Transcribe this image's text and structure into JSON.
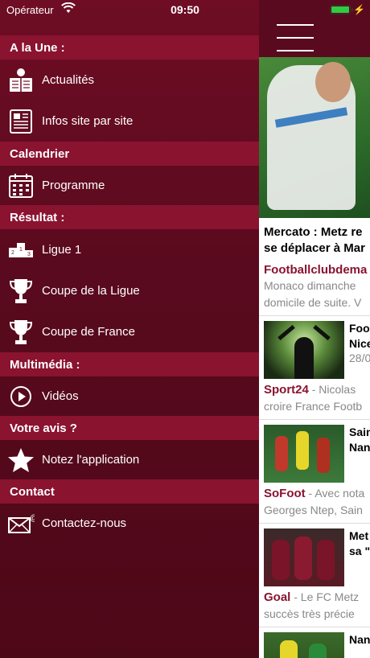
{
  "status_bar": {
    "carrier": "Opérateur",
    "time": "09:50",
    "battery_level": 1.0
  },
  "menu": {
    "sections": [
      {
        "title": "A la Une :",
        "items": [
          {
            "label": "Actualités",
            "icon": "newspaper-reader-icon"
          },
          {
            "label": "Infos site par site",
            "icon": "newspaper-icon"
          }
        ]
      },
      {
        "title": "Calendrier",
        "items": [
          {
            "label": "Programme",
            "icon": "calendar-icon"
          }
        ]
      },
      {
        "title": "Résultat :",
        "items": [
          {
            "label": "Ligue 1",
            "icon": "podium-icon"
          },
          {
            "label": "Coupe de la Ligue",
            "icon": "trophy-icon"
          },
          {
            "label": "Coupe de France",
            "icon": "trophy-icon"
          }
        ]
      },
      {
        "title": "Multimédia :",
        "items": [
          {
            "label": "Vidéos",
            "icon": "play-circle-icon"
          }
        ]
      },
      {
        "title": "Votre avis ?",
        "items": [
          {
            "label": "Notez l'application",
            "icon": "star-icon"
          }
        ]
      },
      {
        "title": "Contact",
        "items": [
          {
            "label": "Contactez-nous",
            "icon": "email-icon"
          }
        ]
      }
    ]
  },
  "feed": {
    "featured": {
      "title_line1": "Mercato : Metz re",
      "title_line2": "se déplacer à Mar",
      "source": "Footballclubdema",
      "snippet_line1": "Monaco dimanche",
      "snippet_line2": "domicile de suite. V"
    },
    "articles": [
      {
        "title_line1": "Foo",
        "title_line2": "Nice",
        "date": "28/0",
        "source": "Sport24",
        "snippet_line1": " - Nicolas",
        "snippet_line2": "croire France Footb"
      },
      {
        "title_line1": "Sain",
        "title_line2": "Nan",
        "date": "",
        "source": "SoFoot",
        "snippet_line1": " - Avec nota",
        "snippet_line2": "Georges Ntep, Sain"
      },
      {
        "title_line1": "Met",
        "title_line2": "sa \"",
        "date": "",
        "source": "Goal",
        "snippet_line1": " - Le FC Metz",
        "snippet_line2": "succès très précie"
      },
      {
        "title_line1": "Nan",
        "title_line2": "",
        "date": "",
        "source": "",
        "snippet_line1": "",
        "snippet_line2": ""
      }
    ]
  }
}
